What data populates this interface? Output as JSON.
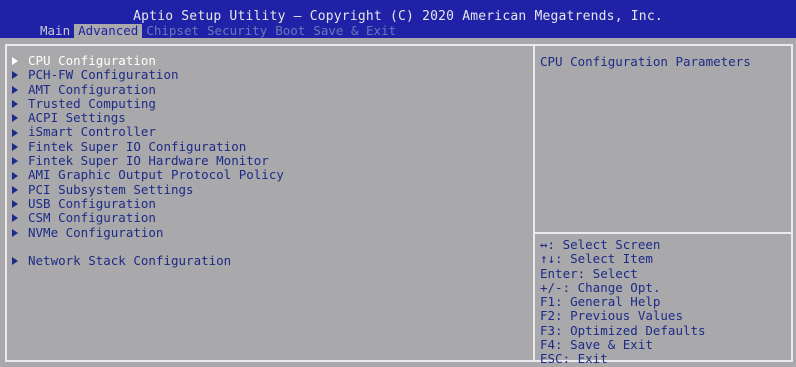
{
  "header": {
    "title": "Aptio Setup Utility – Copyright (C) 2020 American Megatrends, Inc.",
    "tabs": [
      {
        "label": "Main",
        "state": "normal"
      },
      {
        "label": "Advanced",
        "state": "active"
      },
      {
        "label": "Chipset",
        "state": "dim"
      },
      {
        "label": "Security",
        "state": "dim"
      },
      {
        "label": "Boot",
        "state": "dim"
      },
      {
        "label": "Save & Exit",
        "state": "dim"
      }
    ]
  },
  "menu": {
    "items": [
      {
        "label": "CPU Configuration",
        "selected": true
      },
      {
        "label": "PCH-FW Configuration"
      },
      {
        "label": "AMT Configuration"
      },
      {
        "label": "Trusted Computing"
      },
      {
        "label": "ACPI Settings"
      },
      {
        "label": "iSmart Controller"
      },
      {
        "label": "Fintek Super IO Configuration"
      },
      {
        "label": "Fintek Super IO Hardware Monitor"
      },
      {
        "label": "AMI Graphic Output Protocol Policy"
      },
      {
        "label": "PCI Subsystem Settings"
      },
      {
        "label": "USB Configuration"
      },
      {
        "label": "CSM Configuration"
      },
      {
        "label": "NVMe Configuration"
      },
      {
        "label": "Network Stack Configuration"
      }
    ]
  },
  "description": "CPU Configuration Parameters",
  "help": [
    "↔: Select Screen",
    "↑↓: Select Item",
    "Enter: Select",
    "+/-: Change Opt.",
    "F1: General Help",
    "F2: Previous Values",
    "F3: Optimized Defaults",
    "F4: Save & Exit",
    "ESC: Exit"
  ],
  "colors": {
    "header_bg": "#1f22a6",
    "body_bg": "#a9a9ab",
    "text": "#1d2b86",
    "selected": "#ffffff"
  }
}
